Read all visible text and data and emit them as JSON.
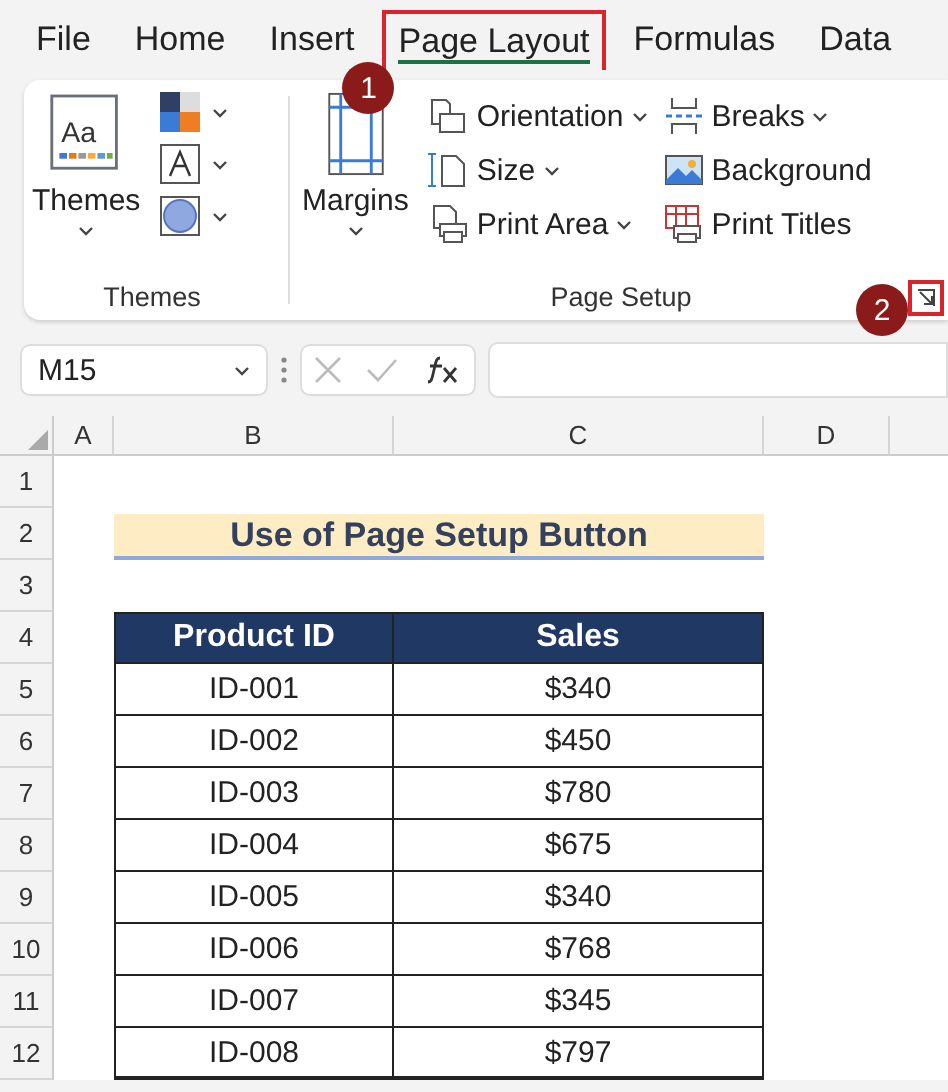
{
  "tabs": [
    {
      "label": "File",
      "selected": false,
      "highlighted": false
    },
    {
      "label": "Home",
      "selected": false,
      "highlighted": false
    },
    {
      "label": "Insert",
      "selected": false,
      "highlighted": false
    },
    {
      "label": "Page Layout",
      "selected": true,
      "highlighted": true,
      "callout": "1"
    },
    {
      "label": "Formulas",
      "selected": false,
      "highlighted": false
    },
    {
      "label": "Data",
      "selected": false,
      "highlighted": false
    }
  ],
  "ribbon": {
    "themes_group": {
      "button": {
        "label": "Themes",
        "icon_text": "Aa"
      },
      "caption": "Themes"
    },
    "page_setup_group": {
      "big_button": {
        "label": "Margins"
      },
      "commands": [
        {
          "kind": "orientation",
          "label": "Orientation",
          "dropdown": true
        },
        {
          "kind": "size",
          "label": "Size",
          "dropdown": true
        },
        {
          "kind": "print-area",
          "label": "Print Area",
          "dropdown": true
        },
        {
          "kind": "breaks",
          "label": "Breaks",
          "dropdown": true
        },
        {
          "kind": "background",
          "label": "Background",
          "dropdown": false
        },
        {
          "kind": "print-titles",
          "label": "Print Titles",
          "dropdown": false
        }
      ],
      "caption": "Page Setup",
      "launcher": {
        "highlighted": true,
        "callout": "2"
      }
    }
  },
  "formula_bar": {
    "name_box": "M15"
  },
  "columns": [
    "A",
    "B",
    "C",
    "D"
  ],
  "rows": [
    "1",
    "2",
    "3",
    "4",
    "5",
    "6",
    "7",
    "8",
    "9",
    "10",
    "11",
    "12"
  ],
  "title": "Use of Page Setup Button",
  "table": {
    "columns": [
      "Product ID",
      "Sales"
    ],
    "rows": [
      [
        "ID-001",
        "$340"
      ],
      [
        "ID-002",
        "$450"
      ],
      [
        "ID-003",
        "$780"
      ],
      [
        "ID-004",
        "$675"
      ],
      [
        "ID-005",
        "$340"
      ],
      [
        "ID-006",
        "$768"
      ],
      [
        "ID-007",
        "$345"
      ],
      [
        "ID-008",
        "$797"
      ]
    ]
  }
}
